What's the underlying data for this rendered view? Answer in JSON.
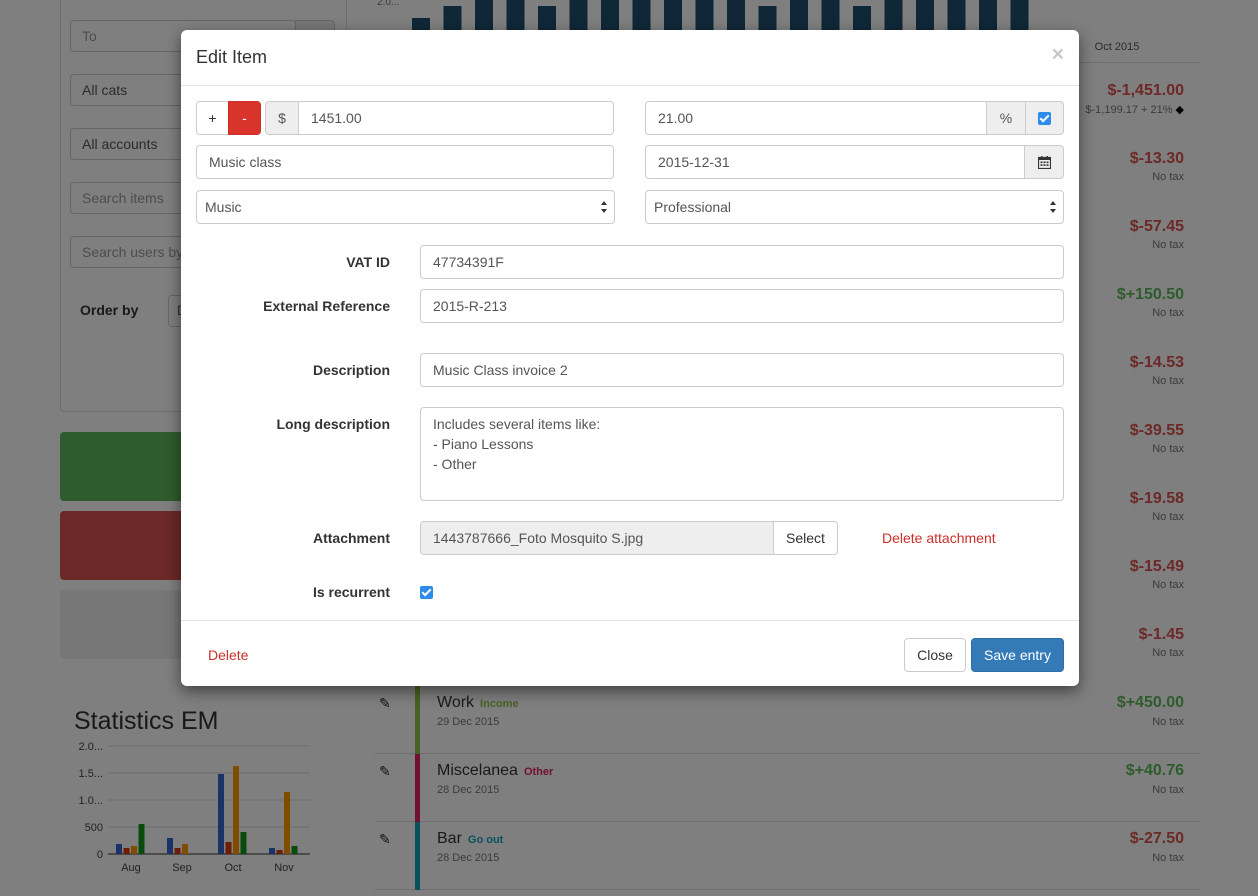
{
  "background": {
    "filters": {
      "to_placeholder": "To",
      "categories_value": "All cats",
      "accounts_value": "All accounts",
      "search_items_placeholder": "Search items",
      "search_users_placeholder": "Search users by",
      "order_by_label": "Order by",
      "order_by_value": "D"
    },
    "top_chart": {
      "y_tick": "2.0...",
      "x_tick": "Oct 2015",
      "bar_color": "#1f4e6e"
    },
    "side_entries": [
      {
        "amount": "$-1,451.00",
        "tax": "$-1,199.17 + 21%",
        "sign": "neg"
      },
      {
        "amount": "$-13.30",
        "tax": "No tax",
        "sign": "neg"
      },
      {
        "amount": "$-57.45",
        "tax": "No tax",
        "sign": "neg"
      },
      {
        "amount": "$+150.50",
        "tax": "No tax",
        "sign": "pos"
      },
      {
        "amount": "$-14.53",
        "tax": "No tax",
        "sign": "neg"
      },
      {
        "amount": "$-39.55",
        "tax": "No tax",
        "sign": "neg"
      },
      {
        "amount": "$-19.58",
        "tax": "No tax",
        "sign": "neg"
      },
      {
        "amount": "$-15.49",
        "tax": "No tax",
        "sign": "neg"
      },
      {
        "amount": "$-1.45",
        "tax": "No tax",
        "sign": "neg"
      }
    ],
    "entries": [
      {
        "name": "Work",
        "category": "Income",
        "category_color": "#8cc63f",
        "date": "29 Dec 2015",
        "amount": "$+450.00",
        "tax": "No tax",
        "sign": "pos"
      },
      {
        "name": "Miscelanea",
        "category": "Other",
        "category_color": "#e0245e",
        "date": "28 Dec 2015",
        "amount": "$+40.76",
        "tax": "No tax",
        "sign": "pos"
      },
      {
        "name": "Bar",
        "category": "Go out",
        "category_color": "#17a2b8",
        "date": "28 Dec 2015",
        "amount": "$-27.50",
        "tax": "No tax",
        "sign": "neg"
      }
    ],
    "stats": {
      "title": "Statistics EM",
      "y_ticks": [
        "2.0...",
        "1.5...",
        "1.0...",
        "500",
        "0"
      ],
      "x_ticks": [
        "Aug",
        "Sep",
        "Oct",
        "Nov"
      ],
      "colors": [
        "#3366cc",
        "#dc3912",
        "#ff9900",
        "#109618"
      ]
    }
  },
  "modal": {
    "title": "Edit Item",
    "close_symbol": "×",
    "plus_label": "+",
    "minus_label": "-",
    "currency_symbol": "$",
    "amount_value": "1451.00",
    "tax_value": "21.00",
    "percent_symbol": "%",
    "tax_enabled": true,
    "concept_value": "Music class",
    "date_value": "2015-12-31",
    "category_value": "Music",
    "account_value": "Professional",
    "vat_id": {
      "label": "VAT ID",
      "value": "47734391F"
    },
    "external_reference": {
      "label": "External Reference",
      "value": "2015-R-213"
    },
    "description": {
      "label": "Description",
      "value": "Music Class invoice 2"
    },
    "long_description": {
      "label": "Long description",
      "value": "Includes several items like:\n- Piano Lessons\n- Other"
    },
    "attachment": {
      "label": "Attachment",
      "value": "1443787666_Foto Mosquito S.jpg",
      "select_label": "Select",
      "delete_label": "Delete attachment"
    },
    "is_recurrent": {
      "label": "Is recurrent",
      "checked": true
    },
    "footer": {
      "delete_label": "Delete",
      "close_label": "Close",
      "save_label": "Save entry"
    }
  }
}
